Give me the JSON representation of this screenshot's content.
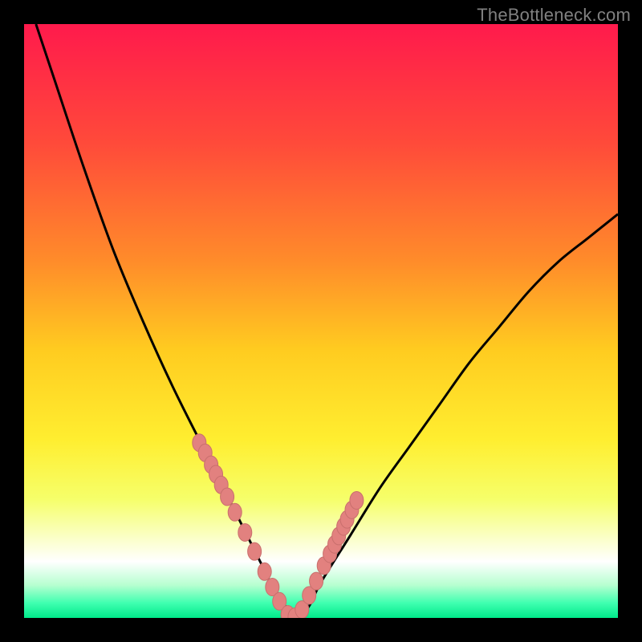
{
  "watermark": "TheBottleneck.com",
  "colors": {
    "gradient_stops": [
      {
        "offset": 0.0,
        "color": "#ff1a4c"
      },
      {
        "offset": 0.2,
        "color": "#ff4a3a"
      },
      {
        "offset": 0.4,
        "color": "#ff8c2a"
      },
      {
        "offset": 0.55,
        "color": "#ffcc20"
      },
      {
        "offset": 0.7,
        "color": "#ffee30"
      },
      {
        "offset": 0.8,
        "color": "#f6ff6a"
      },
      {
        "offset": 0.86,
        "color": "#faffc0"
      },
      {
        "offset": 0.905,
        "color": "#ffffff"
      },
      {
        "offset": 0.945,
        "color": "#b6ffd0"
      },
      {
        "offset": 0.975,
        "color": "#3fffb0"
      },
      {
        "offset": 1.0,
        "color": "#00e98a"
      }
    ],
    "curve": "#000000",
    "marker_fill": "#e2817f",
    "marker_stroke": "#c96f6d"
  },
  "chart_data": {
    "type": "line",
    "title": "",
    "xlabel": "",
    "ylabel": "",
    "xlim": [
      0,
      100
    ],
    "ylim": [
      0,
      100
    ],
    "series": [
      {
        "name": "bottleneck-curve",
        "x": [
          2,
          5,
          10,
          15,
          20,
          25,
          30,
          33,
          36,
          38,
          40,
          42,
          44,
          46,
          48,
          50,
          55,
          60,
          65,
          70,
          75,
          80,
          85,
          90,
          95,
          100
        ],
        "values": [
          100,
          91,
          76,
          62,
          50,
          39,
          29,
          23,
          17,
          13,
          9,
          5,
          2,
          0,
          2,
          6,
          14,
          22,
          29,
          36,
          43,
          49,
          55,
          60,
          64,
          68
        ]
      }
    ],
    "markers": {
      "name": "sample-points",
      "x": [
        29.5,
        30.5,
        31.5,
        32.3,
        33.2,
        34.2,
        35.5,
        37.2,
        38.8,
        40.5,
        41.8,
        43.0,
        44.4,
        45.6,
        46.8,
        48.0,
        49.2,
        50.5,
        51.5,
        52.3,
        53.0,
        53.8,
        54.4,
        55.2,
        56.0
      ],
      "values": [
        29.5,
        27.8,
        25.8,
        24.2,
        22.4,
        20.4,
        17.8,
        14.4,
        11.2,
        7.8,
        5.2,
        2.8,
        0.6,
        0.2,
        1.4,
        3.8,
        6.2,
        8.8,
        10.8,
        12.4,
        13.8,
        15.4,
        16.6,
        18.2,
        19.8
      ]
    }
  }
}
